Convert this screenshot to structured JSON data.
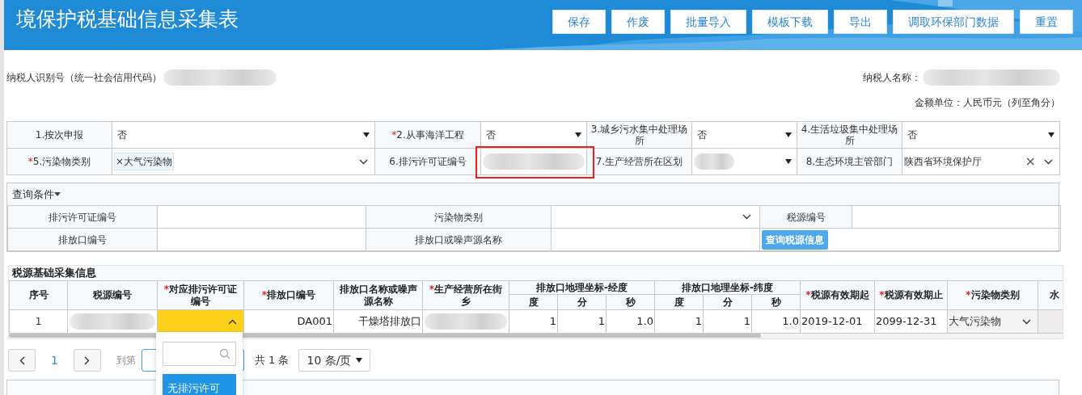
{
  "header": {
    "title": "境保护税基础信息采集表",
    "buttons": [
      "保存",
      "作废",
      "批量导入",
      "模板下载",
      "导出",
      "调取环保部门数据",
      "重置"
    ]
  },
  "taxpayer": {
    "id_label": "纳税人识别号（统一社会信用代码）",
    "name_label": "纳税人名称：",
    "unit": "金额单位：人民币元（列至角分）"
  },
  "form_fields": [
    {
      "label": "1.按次申报",
      "kind": "select",
      "value": "否"
    },
    {
      "label": "2.从事海洋工程",
      "required_mark": "*",
      "kind": "select",
      "value": "否"
    },
    {
      "label": "3.城乡污水集中处理场所",
      "kind": "select",
      "value": "否"
    },
    {
      "label": "4.生活垃圾集中处理场所",
      "kind": "select",
      "value": "否"
    },
    {
      "label": "5.污染物类别",
      "required_mark": "*",
      "kind": "tags",
      "tags": [
        {
          "remove": "×",
          "text": "大气污染物"
        }
      ]
    },
    {
      "label": "6.排污许可证编号",
      "kind": "redacted",
      "highlighted": true
    },
    {
      "label": "7.生产经营所在区划",
      "kind": "redacted_select"
    },
    {
      "label": "8.生态环境主管部门",
      "kind": "clearable",
      "value": "陕西省环境保护厅",
      "clear": "×"
    }
  ],
  "query": {
    "title": "查询条件",
    "expanded": true,
    "fields": [
      {
        "label": "排污许可证编号",
        "kind": "input"
      },
      {
        "label": "污染物类别",
        "kind": "select"
      },
      {
        "label": "税源编号",
        "kind": "input"
      },
      {
        "label": "排放口编号",
        "kind": "input"
      },
      {
        "label": "排放口或噪声源名称",
        "kind": "input"
      }
    ],
    "button": "查询税源信息"
  },
  "sources": {
    "title": "税源基础采集信息",
    "columns": [
      {
        "label": "序号"
      },
      {
        "label": "税源编号"
      },
      {
        "label": "对应排污许可证编号",
        "required_mark": "*"
      },
      {
        "label": "排放口编号",
        "required_mark": "*"
      },
      {
        "label": "排放口名称或噪声源名称"
      },
      {
        "label": "生产经营所在街乡",
        "required_mark": "*"
      },
      {
        "label": "排放口地理坐标-经度",
        "colspan": 3,
        "children": [
          {
            "label": "度"
          },
          {
            "label": "分"
          },
          {
            "label": "秒"
          }
        ]
      },
      {
        "label": "排放口地理坐标-纬度",
        "colspan": 3,
        "children": [
          {
            "label": "度"
          },
          {
            "label": "分"
          },
          {
            "label": "秒"
          }
        ]
      },
      {
        "label": "税源有效期起",
        "required_mark": "*"
      },
      {
        "label": "税源有效期止",
        "required_mark": "*"
      },
      {
        "label": "污染物类别",
        "required_mark": "*"
      },
      {
        "label": "水"
      }
    ],
    "rows": [
      {
        "cells": [
          {
            "kind": "index",
            "text": "1"
          },
          {
            "kind": "redacted"
          },
          {
            "kind": "open_select"
          },
          {
            "kind": "value",
            "text": "DA001"
          },
          {
            "kind": "value",
            "text": "干燥塔排放口"
          },
          {
            "kind": "redacted"
          },
          {
            "kind": "value",
            "text": "1"
          },
          {
            "kind": "value",
            "text": "1"
          },
          {
            "kind": "value",
            "text": "1.0"
          },
          {
            "kind": "value",
            "text": "1"
          },
          {
            "kind": "value",
            "text": "1"
          },
          {
            "kind": "value",
            "text": "1.0"
          },
          {
            "kind": "date",
            "text": "2019-12-01"
          },
          {
            "kind": "date",
            "text": "2099-12-31"
          },
          {
            "kind": "select",
            "text": "大气污染物"
          },
          {
            "kind": "blank"
          }
        ]
      }
    ]
  },
  "pagination": {
    "page": "1",
    "goto_label": "到第",
    "total": "共 1 条",
    "page_size": "10 条/页"
  },
  "dropdown": {
    "options": [
      {
        "text": "无排污许可",
        "selected": true
      }
    ]
  }
}
